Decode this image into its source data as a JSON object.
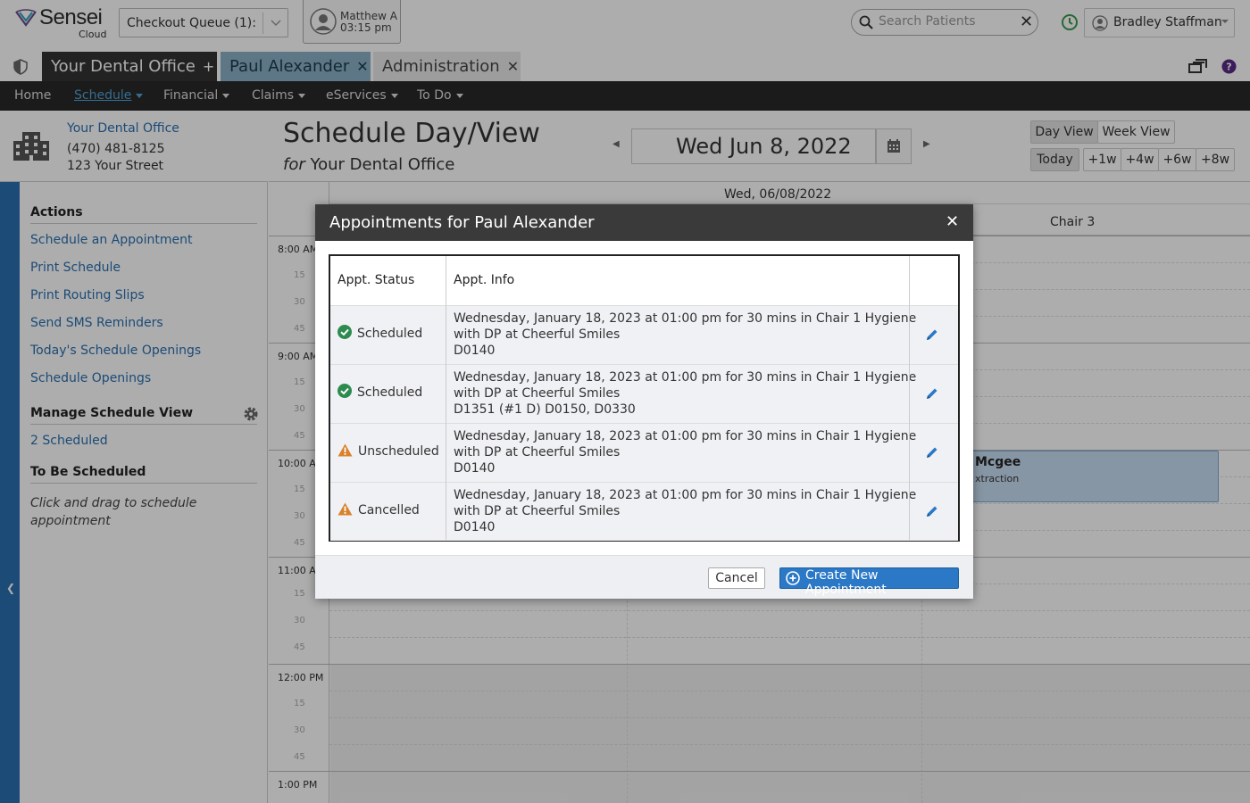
{
  "app": {
    "brand": "Sensei",
    "brand_sub": "Cloud",
    "checkout_queue": "Checkout Queue (1):",
    "provider": {
      "name": "Matthew A",
      "time": "03:15 pm"
    },
    "search_placeholder": "Search Patients",
    "user": "Bradley Staffman"
  },
  "tabs": [
    {
      "label": "Your Dental Office",
      "action": "+"
    },
    {
      "label": "Paul Alexander",
      "action": "✕"
    },
    {
      "label": "Administration",
      "action": "✕"
    }
  ],
  "nav": [
    {
      "label": "Home"
    },
    {
      "label": "Schedule"
    },
    {
      "label": "Financial"
    },
    {
      "label": "Claims"
    },
    {
      "label": "eServices"
    },
    {
      "label": "To Do"
    }
  ],
  "office": {
    "name": "Your Dental Office",
    "phone": "(470) 481-8125",
    "street": "123 Your Street"
  },
  "sidebar": {
    "actions_heading": "Actions",
    "actions": [
      "Schedule an Appointment",
      "Print Schedule",
      "Print Routing Slips",
      "Send SMS Reminders",
      "Today's Schedule Openings",
      "Schedule Openings"
    ],
    "manage_heading": "Manage Schedule View",
    "manage_link": "2 Scheduled",
    "tbs_heading": "To Be Scheduled",
    "tbs_hint": "Click and drag to schedule appointment"
  },
  "schedule": {
    "title": "Schedule Day/View",
    "for_word": "for",
    "office": "Your Dental Office",
    "date": "Wed Jun 8, 2022",
    "day_label": "Wed, 06/08/2022",
    "chair": "Chair 3",
    "views": [
      "Day View",
      "Week View"
    ],
    "jumps": [
      "Today",
      "+1w",
      "+4w",
      "+6w",
      "+8w"
    ],
    "hours": [
      "8:00 AM",
      "9:00 AM",
      "10:00 AM",
      "11:00 AM",
      "12:00 PM",
      "1:00 PM"
    ],
    "quarters": [
      "15",
      "30",
      "45"
    ],
    "bg_appt": {
      "name": "Mcgee",
      "detail": "xtraction"
    }
  },
  "modal": {
    "title": "Appointments for Paul Alexander",
    "col_status": "Appt. Status",
    "col_info": "Appt. Info",
    "rows": [
      {
        "status": "Scheduled",
        "status_icon": "check-circle-icon",
        "line1": "Wednesday, January 18, 2023 at 01:00 pm for 30 mins in Chair 1 Hygiene",
        "line2": "with DP at Cheerful Smiles",
        "line3": "D0140"
      },
      {
        "status": "Scheduled",
        "status_icon": "check-circle-icon",
        "line1": "Wednesday, January 18, 2023 at 01:00 pm for 30 mins in Chair 1 Hygiene",
        "line2": "with DP at Cheerful Smiles",
        "line3": "D1351 (#1 D) D0150, D0330"
      },
      {
        "status": "Unscheduled",
        "status_icon": "warning-icon",
        "line1": "Wednesday, January 18, 2023 at 01:00 pm for 30 mins in Chair 1 Hygiene",
        "line2": "with DP at Cheerful Smiles",
        "line3": "D0140"
      },
      {
        "status": "Cancelled",
        "status_icon": "warning-icon",
        "line1": "Wednesday, January 18, 2023 at 01:00 pm for 30 mins in Chair 1 Hygiene",
        "line2": "with DP at Cheerful Smiles",
        "line3": "D0140"
      }
    ],
    "cancel": "Cancel",
    "create": "Create New Appointment"
  },
  "colors": {
    "accent": "#2a78c6",
    "link": "#2a6fb0",
    "nav_bg": "#282828",
    "ok": "#2e8b4f",
    "warn": "#d9822b"
  }
}
